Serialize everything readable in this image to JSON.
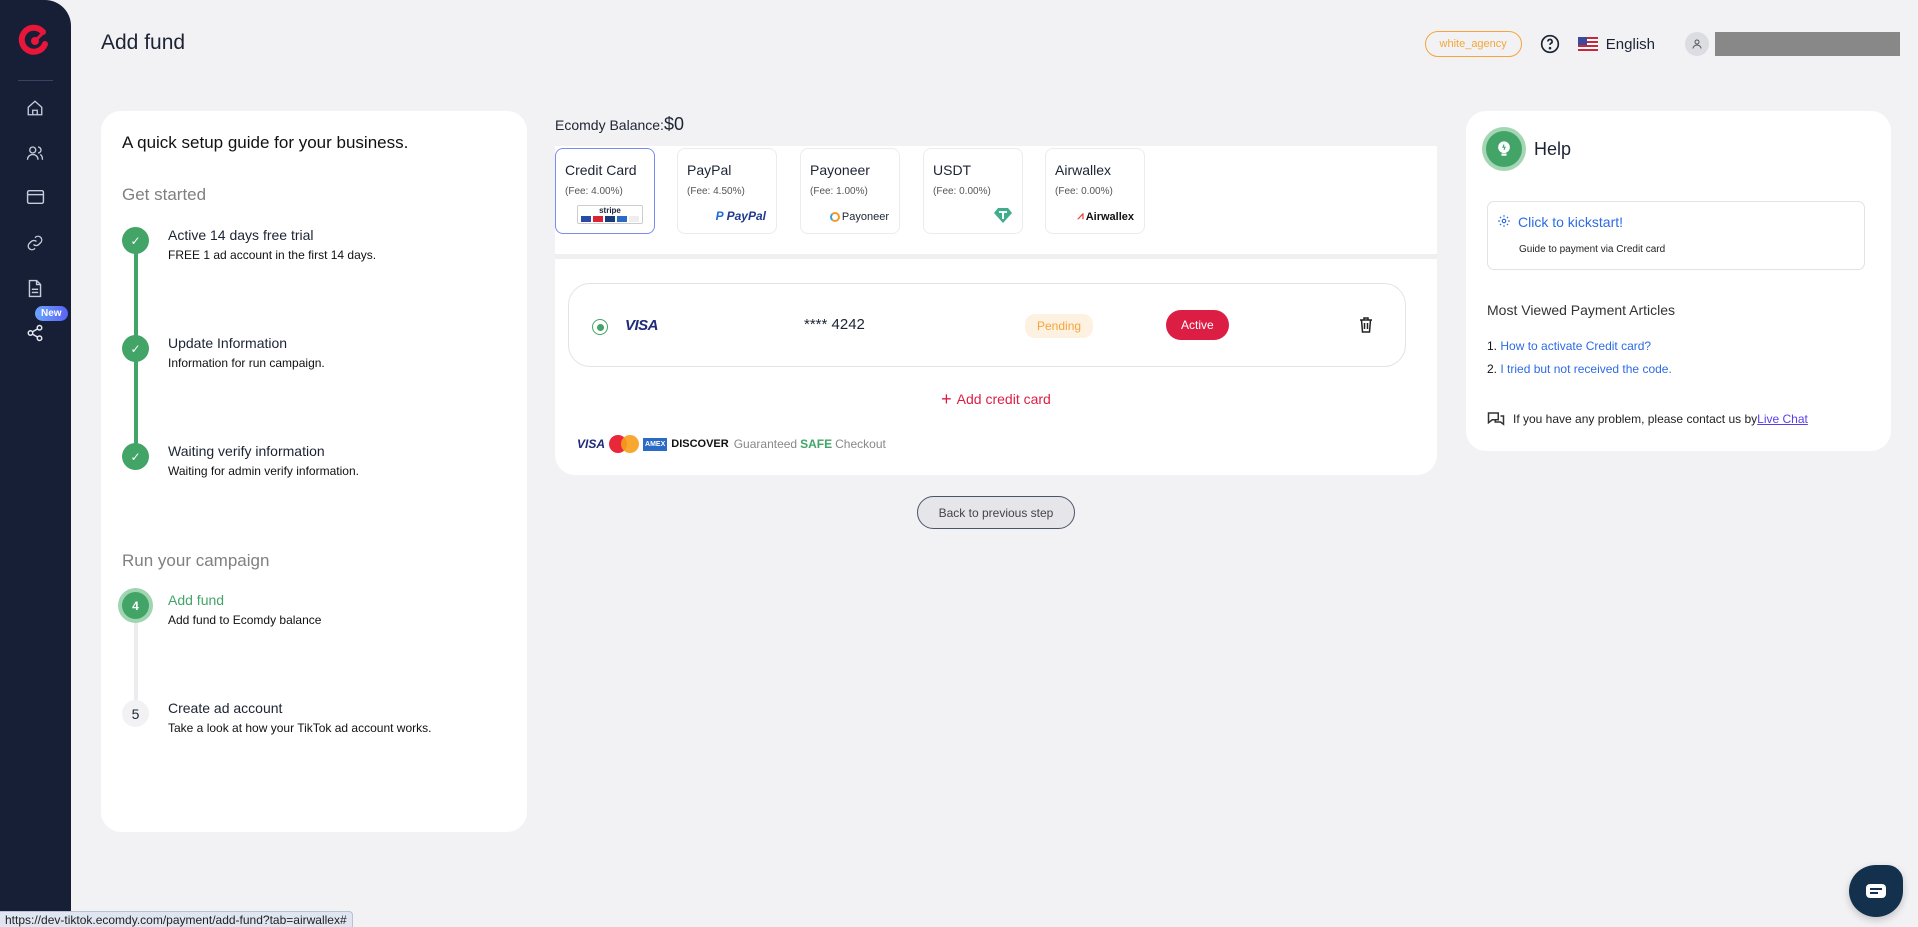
{
  "app": {
    "brand": "Ecomdy",
    "accent": "#e8173a"
  },
  "sidebar": {
    "items": [
      {
        "name": "home",
        "icon": "home-icon"
      },
      {
        "name": "users",
        "icon": "users-icon"
      },
      {
        "name": "payment",
        "icon": "credit-card-icon"
      },
      {
        "name": "links",
        "icon": "link-icon"
      },
      {
        "name": "documents",
        "icon": "document-icon"
      },
      {
        "name": "referral",
        "icon": "share-icon",
        "badge": "New"
      }
    ]
  },
  "header": {
    "title": "Add fund",
    "agency_badge": "white_agency",
    "language": "English"
  },
  "guide": {
    "title": "A quick setup guide for your business.",
    "sections": [
      {
        "title": "Get started"
      },
      {
        "title": "Run your campaign"
      }
    ],
    "steps": [
      {
        "title": "Active 14 days free trial",
        "desc": "FREE 1 ad account in the first 14 days.",
        "status": "done"
      },
      {
        "title": "Update Information",
        "desc": "Information for run campaign.",
        "status": "done"
      },
      {
        "title": "Waiting verify information",
        "desc": "Waiting for admin verify information.",
        "status": "done"
      },
      {
        "number": "4",
        "title": "Add fund",
        "desc": "Add fund to Ecomdy balance",
        "status": "current"
      },
      {
        "number": "5",
        "title": "Create ad account",
        "desc": "Take a look at how your TikTok ad account works.",
        "status": "todo"
      }
    ]
  },
  "balance": {
    "label": "Ecomdy Balance:",
    "amount": "$0"
  },
  "methods": [
    {
      "name": "Credit Card",
      "fee": "(Fee: 4.00%)",
      "logo": "stripe-cards",
      "selected": true
    },
    {
      "name": "PayPal",
      "fee": "(Fee: 4.50%)",
      "logo": "PayPal"
    },
    {
      "name": "Payoneer",
      "fee": "(Fee: 1.00%)",
      "logo": "Payoneer"
    },
    {
      "name": "USDT",
      "fee": "(Fee: 0.00%)",
      "logo": "tether"
    },
    {
      "name": "Airwallex",
      "fee": "(Fee: 0.00%)",
      "logo": "Airwallex"
    }
  ],
  "stripe_label": "stripe",
  "saved_card": {
    "brand": "VISA",
    "number": "**** 4242",
    "status": "Pending",
    "action": "Active"
  },
  "add_card_label": "Add credit card",
  "checkout": {
    "visa": "VISA",
    "amex": "AMEX",
    "discover": "DISCOVER",
    "prefix": "Guaranteed",
    "safe": "SAFE",
    "suffix": "Checkout"
  },
  "back_button": "Back to previous step",
  "help": {
    "title": "Help",
    "kickstart_title": "Click to kickstart!",
    "kickstart_desc": "Guide to payment via Credit card",
    "articles_title": "Most Viewed Payment Articles",
    "articles": [
      {
        "num": "1.",
        "label": "How to activate Credit card?"
      },
      {
        "num": "2.",
        "label": "I tried but not received the code."
      }
    ],
    "contact_text": "If you have any problem, please contact us by",
    "contact_link": " Live Chat"
  },
  "status_bar_url": "https://dev-tiktok.ecomdy.com/payment/add-fund?tab=airwallex#"
}
